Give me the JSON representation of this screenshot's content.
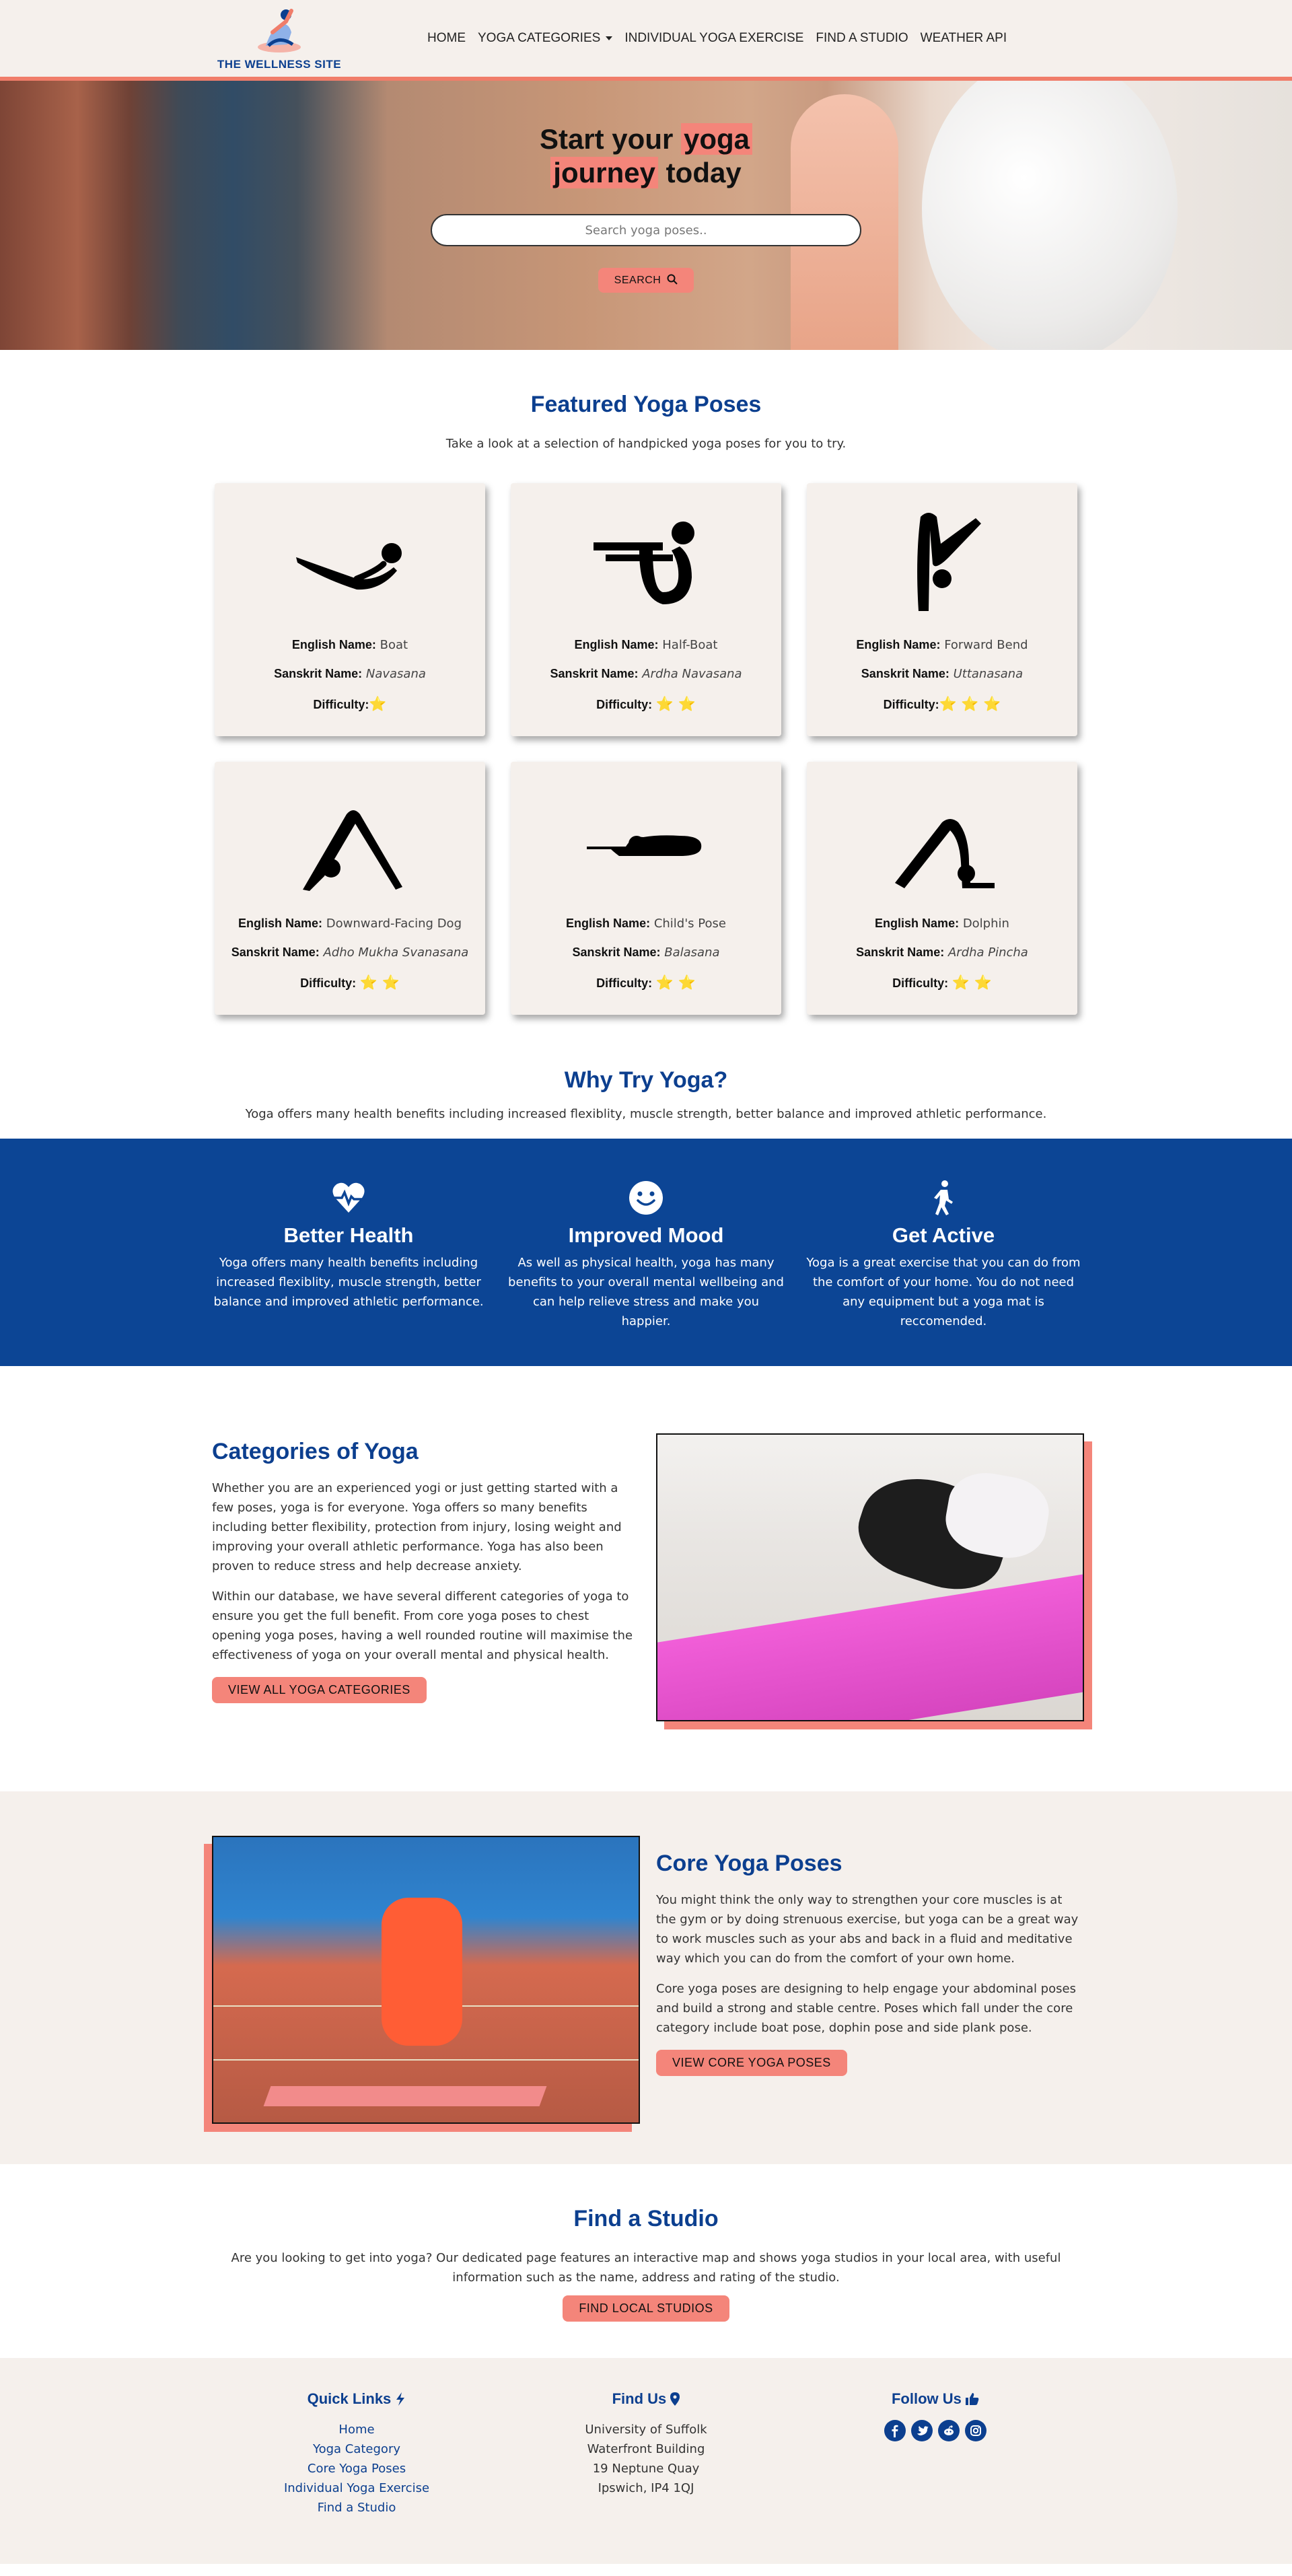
{
  "nav": {
    "logo_text": "THE WELLNESS SITE",
    "items": [
      {
        "label": "HOME"
      },
      {
        "label": "YOGA CATEGORIES"
      },
      {
        "label": "INDIVIDUAL YOGA EXERCISE"
      },
      {
        "label": "FIND A STUDIO"
      },
      {
        "label": "WEATHER API"
      }
    ]
  },
  "hero": {
    "title_1": "Start your",
    "title_hl_1": "yoga",
    "title_hl_2": "journey",
    "title_2": "today",
    "search_placeholder": "Search yoga poses..",
    "search_button": "SEARCH"
  },
  "featured": {
    "title": "Featured Yoga Poses",
    "subtitle": "Take a look at a selection of handpicked yoga poses for you to try.",
    "labels": {
      "english": "English Name:",
      "sanskrit": "Sanskrit Name:",
      "difficulty": "Difficulty:"
    },
    "poses": [
      {
        "english": "Boat",
        "sanskrit": "Navasana",
        "stars": "⭐",
        "icon": "boat-pose-icon"
      },
      {
        "english": "Half-Boat",
        "sanskrit": "Ardha Navasana",
        "stars": "⭐ ⭐",
        "icon": "half-boat-pose-icon"
      },
      {
        "english": "Forward Bend",
        "sanskrit": "Uttanasana",
        "stars": "⭐ ⭐ ⭐",
        "icon": "forward-bend-pose-icon"
      },
      {
        "english": "Downward-Facing Dog",
        "sanskrit": "Adho Mukha Svanasana",
        "stars": "⭐ ⭐",
        "icon": "downward-dog-pose-icon"
      },
      {
        "english": "Child's Pose",
        "sanskrit": "Balasana",
        "stars": "⭐ ⭐",
        "icon": "childs-pose-icon"
      },
      {
        "english": "Dolphin",
        "sanskrit": "Ardha Pincha",
        "stars": "⭐ ⭐",
        "icon": "dolphin-pose-icon"
      }
    ]
  },
  "why": {
    "title": "Why Try Yoga?",
    "subtitle": "Yoga offers many health benefits including increased flexiblity, muscle strength, better balance and improved athletic performance.",
    "benefits": [
      {
        "title": "Better Health",
        "text": "Yoga offers many health benefits including increased flexiblity, muscle strength, better balance and improved athletic performance.",
        "icon": "heart-pulse-icon"
      },
      {
        "title": "Improved Mood",
        "text": "As well as physical health, yoga has many benefits to your overall mental wellbeing and can help relieve stress and make you happier.",
        "icon": "smile-icon"
      },
      {
        "title": "Get Active",
        "text": "Yoga is a great exercise that you can do from the comfort of your home. You do not need any equipment but a yoga mat is reccomended.",
        "icon": "walking-icon"
      }
    ]
  },
  "categories": {
    "title": "Categories of Yoga",
    "p1": "Whether you are an experienced yogi or just getting started with a few poses, yoga is for everyone. Yoga offers so many benefits including better flexibility, protection from injury, losing weight and improving your overall athletic performance. Yoga has also been proven to reduce stress and help decrease anxiety.",
    "p2": "Within our database, we have several different categories of yoga to ensure you get the full benefit. From core yoga poses to chest opening yoga poses, having a well rounded routine will maximise the effectiveness of yoga on your overall mental and physical health.",
    "button": "VIEW ALL YOGA CATEGORIES"
  },
  "core": {
    "title": "Core Yoga Poses",
    "p1": "You might think the only way to strengthen your core muscles is at the gym or by doing strenuous exercise, but yoga can be a great way to work muscles such as your abs and back in a fluid and meditative way which you can do from the comfort of your own home.",
    "p2": "Core yoga poses are designing to help engage your abdominal poses and build a strong and stable centre. Poses which fall under the core category include boat pose, dophin pose and side plank pose.",
    "button": "VIEW CORE YOGA POSES"
  },
  "studio": {
    "title": "Find a Studio",
    "text": "Are you looking to get into yoga? Our dedicated page features an interactive map and shows yoga studios in your local area, with useful information such as the name, address and rating of the studio.",
    "button": "FIND LOCAL STUDIOS"
  },
  "footer": {
    "quick_links_title": "Quick Links",
    "links": [
      "Home",
      "Yoga Category",
      "Core Yoga Poses",
      "Individual Yoga Exercise",
      "Find a Studio"
    ],
    "find_us_title": "Find Us",
    "address": [
      "University of Suffolk",
      "Waterfront Building",
      "19 Neptune Quay",
      "Ipswich, IP4 1QJ"
    ],
    "follow_title": "Follow Us",
    "social": [
      "facebook-icon",
      "twitter-icon",
      "reddit-icon",
      "instagram-icon"
    ]
  },
  "colors": {
    "accent": "#f4857a",
    "brand": "#0c3f8f",
    "background": "#f5f0ec"
  }
}
